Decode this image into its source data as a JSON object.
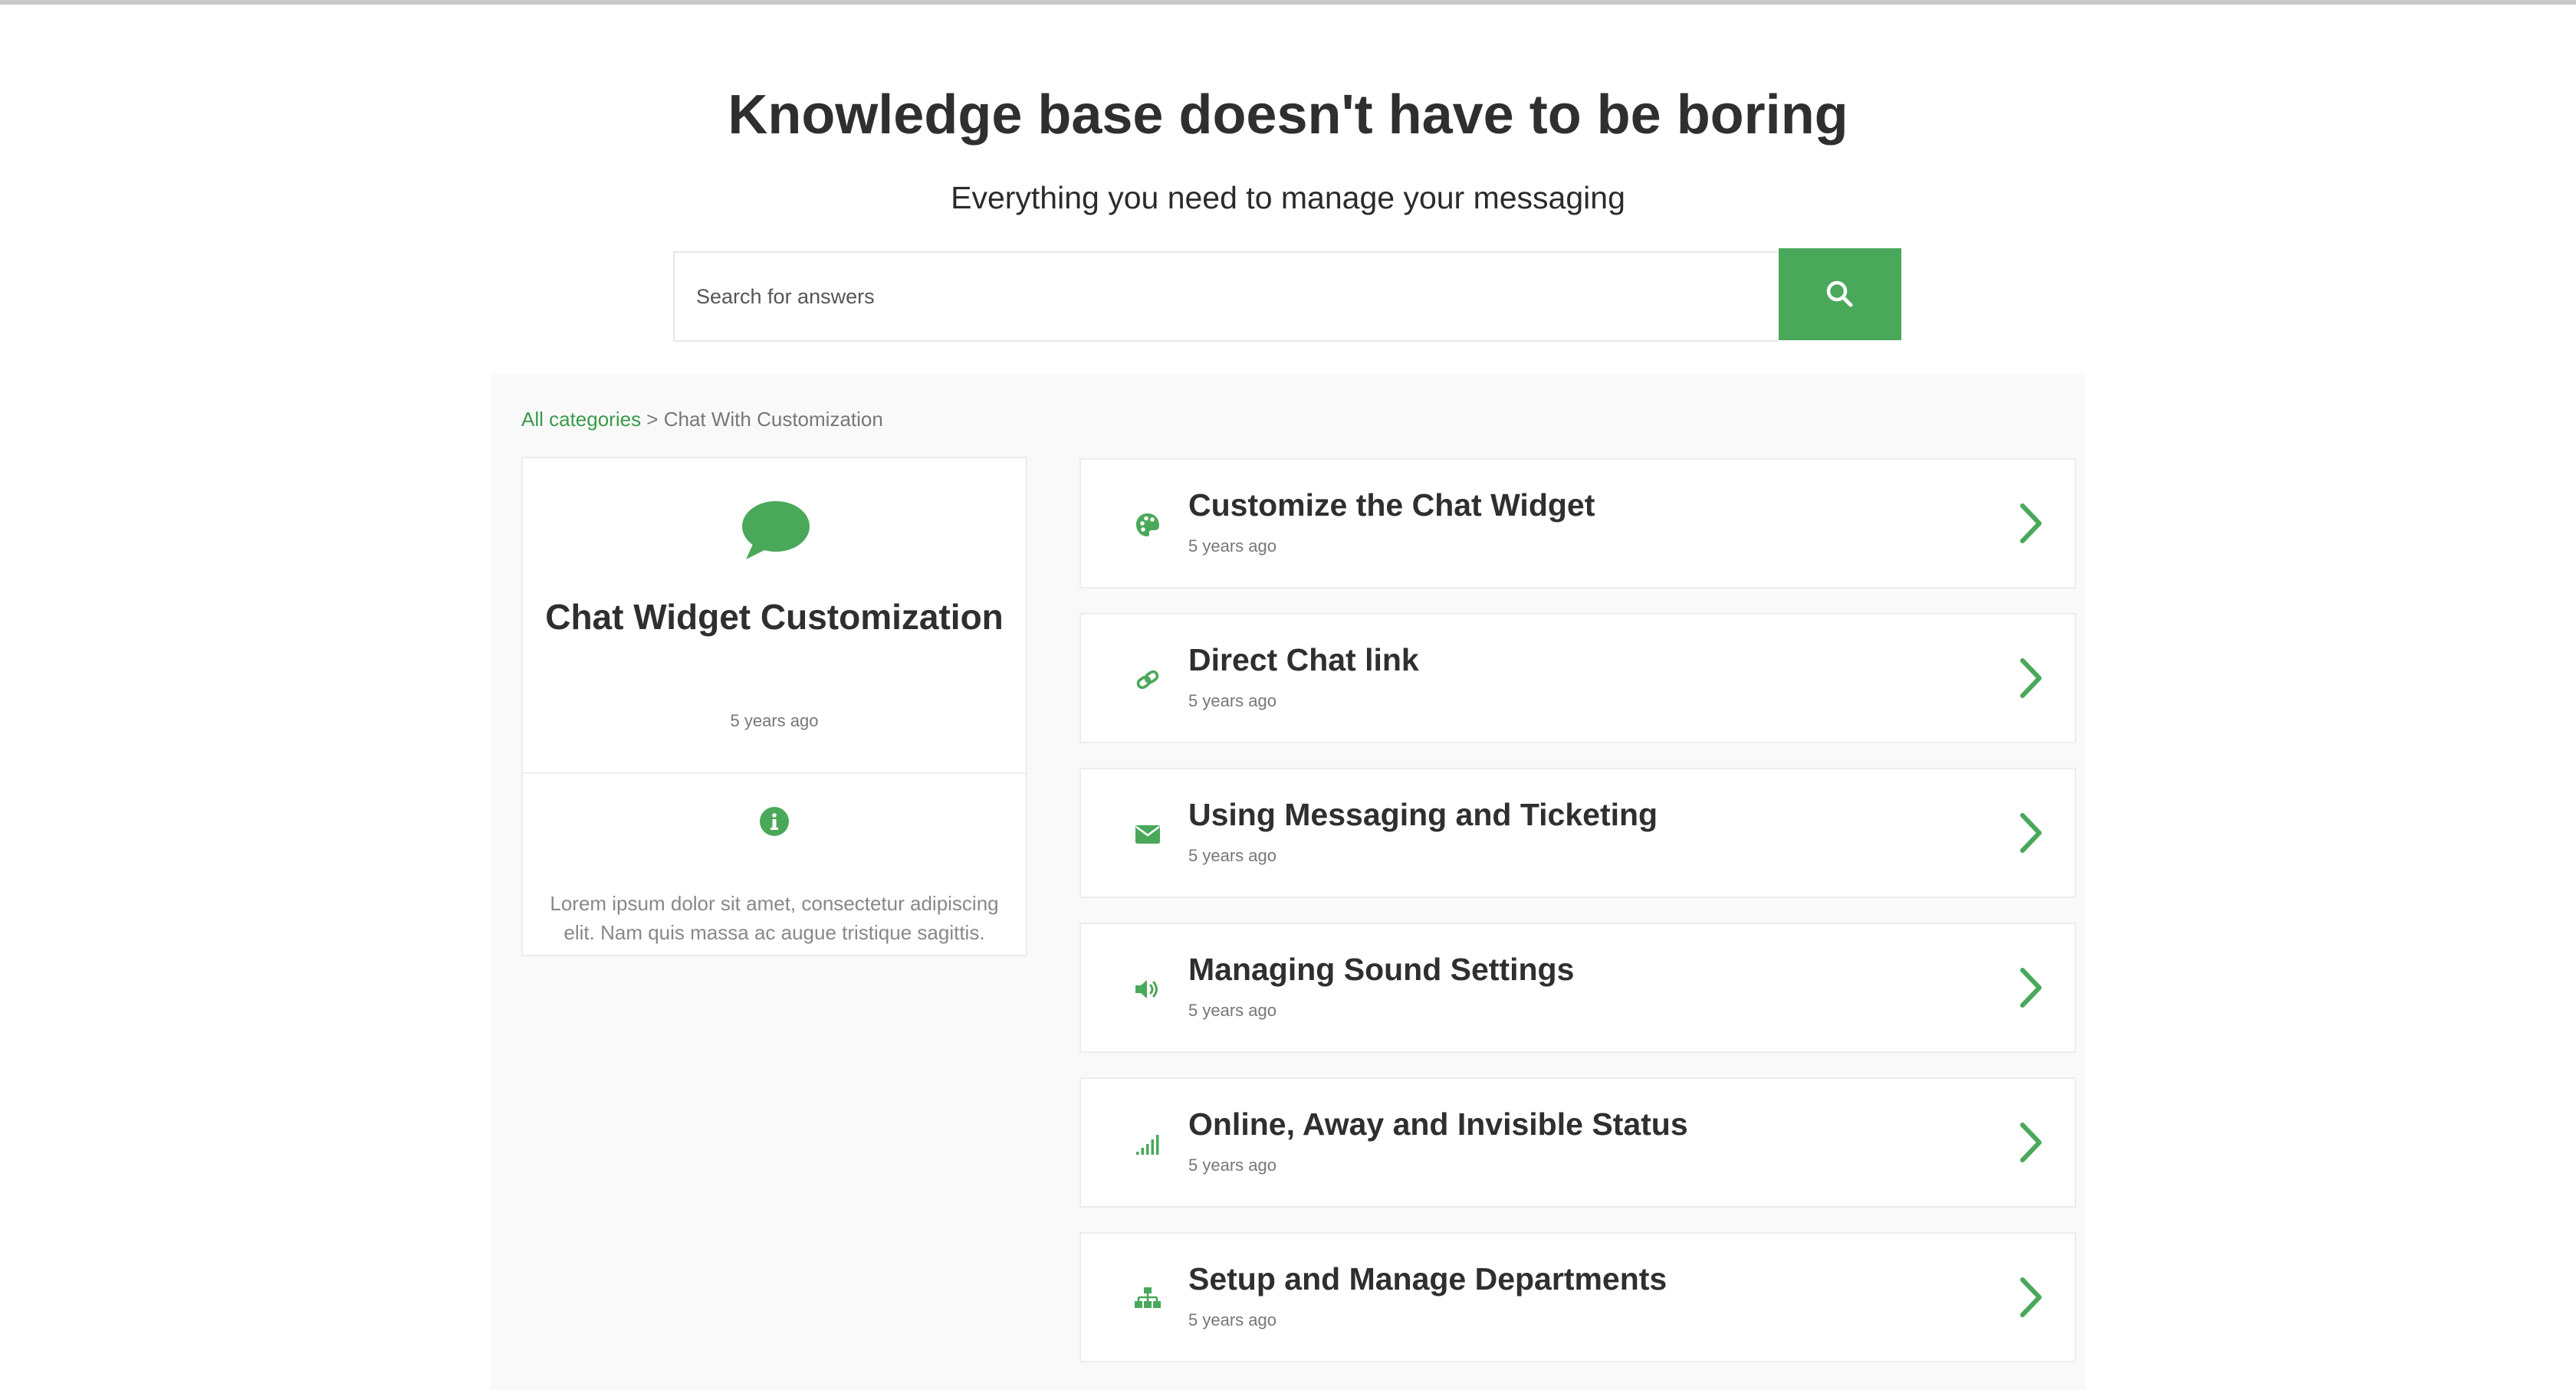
{
  "hero": {
    "title": "Knowledge base doesn't have to be boring",
    "subtitle": "Everything you need to manage your messaging"
  },
  "search": {
    "placeholder": "Search for answers",
    "button_icon": "search-icon"
  },
  "breadcrumb": {
    "root_link": "All categories",
    "separator": " > ",
    "current": "Chat With Customization"
  },
  "category": {
    "icon": "chat-bubble-icon",
    "title": "Chat Widget Customization",
    "date": "5 years ago",
    "info_icon": "info-icon",
    "description": "Lorem ipsum dolor sit amet, consectetur adipiscing elit. Nam quis massa ac augue tristique sagittis."
  },
  "articles": [
    {
      "title": "Customize the Chat Widget",
      "date": "5 years ago",
      "icon": "palette-icon"
    },
    {
      "title": "Direct Chat link",
      "date": "5 years ago",
      "icon": "link-icon"
    },
    {
      "title": "Using Messaging and Ticketing",
      "date": "5 years ago",
      "icon": "envelope-icon"
    },
    {
      "title": "Managing Sound Settings",
      "date": "5 years ago",
      "icon": "speaker-icon"
    },
    {
      "title": "Online, Away and Invisible Status",
      "date": "5 years ago",
      "icon": "signal-bars-icon"
    },
    {
      "title": "Setup and Manage Departments",
      "date": "5 years ago",
      "icon": "org-chart-icon"
    }
  ],
  "colors": {
    "accent": "#4aa85a",
    "panel_background": "#f9f9f9",
    "title_text": "#2f2f2f",
    "muted_text": "#777777"
  }
}
